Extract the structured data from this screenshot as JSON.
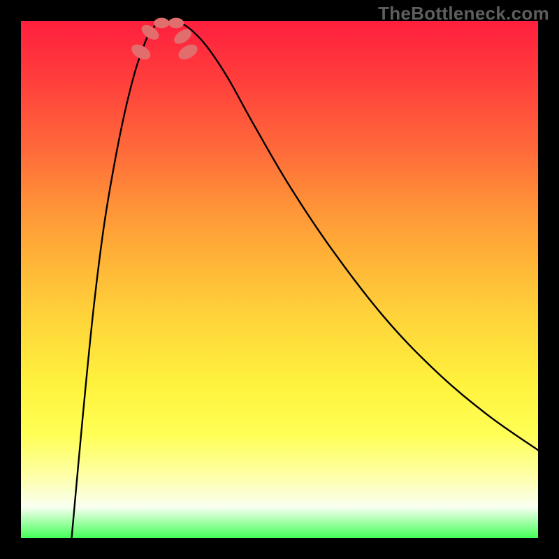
{
  "watermark": "TheBottleneck.com",
  "chart_data": {
    "type": "line",
    "title": "",
    "xlabel": "",
    "ylabel": "",
    "xlim": [
      0,
      100
    ],
    "ylim": [
      0,
      100
    ],
    "background": "vertical-gradient-red-yellow-green",
    "series": [
      {
        "name": "left-branch",
        "x": [
          9.8,
          12,
          14,
          16,
          18,
          20,
          22,
          23.5,
          24.5,
          25.5,
          26.0,
          26.5
        ],
        "y": [
          0,
          24,
          44,
          60,
          72,
          82,
          90,
          94.5,
          97,
          98.5,
          99.2,
          99.6
        ]
      },
      {
        "name": "right-branch",
        "x": [
          31,
          33,
          36,
          40,
          45,
          52,
          60,
          70,
          80,
          90,
          100
        ],
        "y": [
          99.6,
          98.2,
          95,
          89,
          80,
          68,
          56,
          43,
          32.5,
          24,
          17
        ]
      },
      {
        "name": "floor",
        "x": [
          26.5,
          31
        ],
        "y": [
          99.6,
          99.6
        ]
      }
    ],
    "markers": [
      {
        "name": "marker-left-upper",
        "x": 23.2,
        "y": 94.0,
        "rx": 1.2,
        "ry": 2.0,
        "rot": -60
      },
      {
        "name": "marker-left-lower",
        "x": 25.0,
        "y": 97.8,
        "rx": 1.1,
        "ry": 1.9,
        "rot": -55
      },
      {
        "name": "marker-right-upper",
        "x": 32.3,
        "y": 94.0,
        "rx": 1.2,
        "ry": 2.0,
        "rot": 60
      },
      {
        "name": "marker-right-lower",
        "x": 31.3,
        "y": 97.0,
        "rx": 1.1,
        "ry": 1.9,
        "rot": 55
      },
      {
        "name": "marker-bottom-left",
        "x": 27.2,
        "y": 99.6,
        "rx": 1.5,
        "ry": 1.0,
        "rot": 0
      },
      {
        "name": "marker-bottom-right",
        "x": 30.0,
        "y": 99.6,
        "rx": 1.5,
        "ry": 1.0,
        "rot": 0
      }
    ]
  }
}
